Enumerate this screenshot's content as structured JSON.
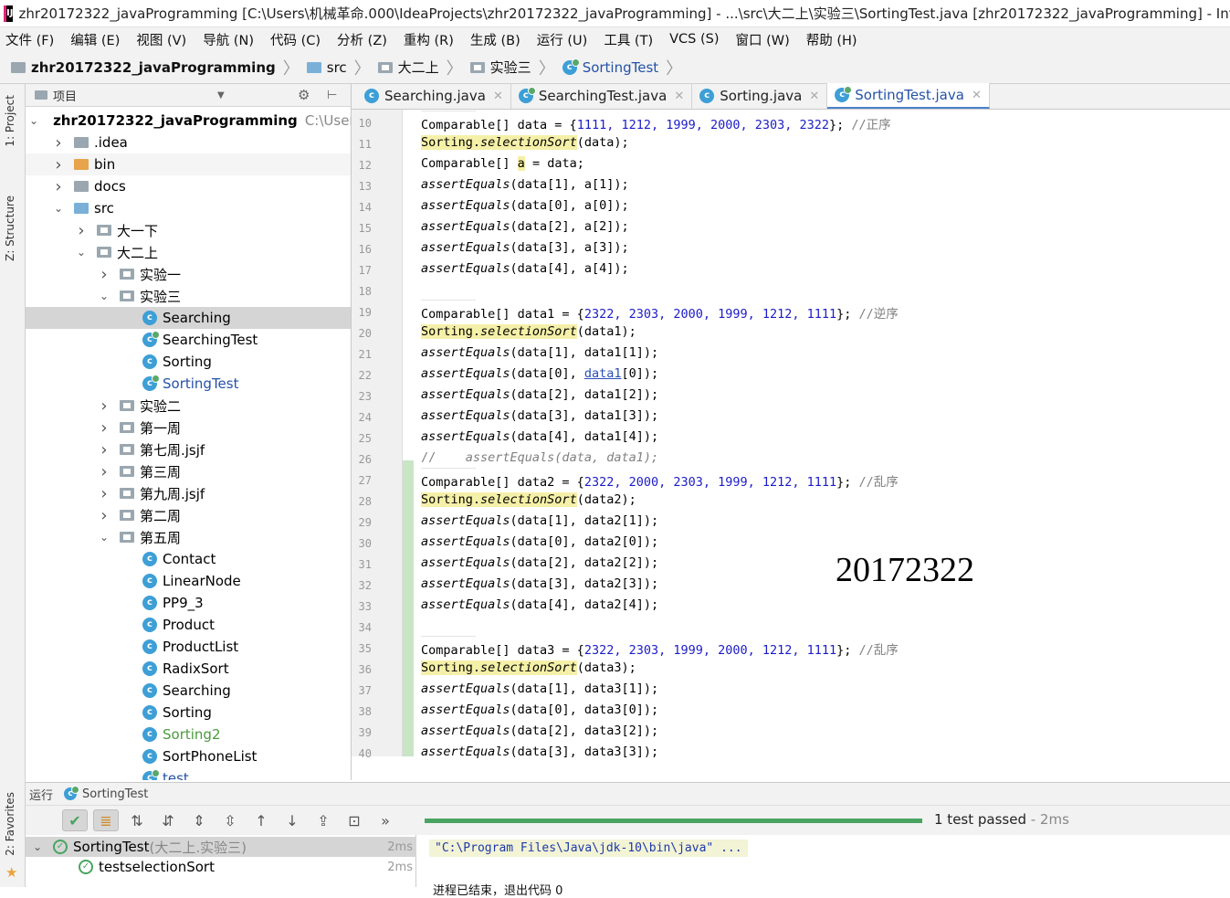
{
  "window": {
    "title": "zhr20172322_javaProgramming [C:\\Users\\机械革命.000\\IdeaProjects\\zhr20172322_javaProgramming] - ...\\src\\大二上\\实验三\\SortingTest.java [zhr20172322_javaProgramming] - IntelliJ",
    "app_icon": "IJ"
  },
  "menu": [
    "文件 (F)",
    "编辑 (E)",
    "视图 (V)",
    "导航 (N)",
    "代码 (C)",
    "分析 (Z)",
    "重构 (R)",
    "生成 (B)",
    "运行 (U)",
    "工具 (T)",
    "VCS (S)",
    "窗口 (W)",
    "帮助 (H)"
  ],
  "breadcrumb": [
    "zhr20172322_javaProgramming",
    "src",
    "大二上",
    "实验三",
    "SortingTest"
  ],
  "left_strip": {
    "project": "1: Project",
    "structure": "Z: Structure",
    "favorites": "2: Favorites"
  },
  "project_panel": {
    "header": "项目",
    "rows": [
      {
        "label": "zhr20172322_javaProgramming",
        "extra": "C:\\Users",
        "arrow": "down",
        "icon": "module"
      },
      {
        "label": ".idea",
        "arrow": "right",
        "icon": "folder"
      },
      {
        "label": "bin",
        "arrow": "right",
        "icon": "folder-orange"
      },
      {
        "label": "docs",
        "arrow": "right",
        "icon": "folder"
      },
      {
        "label": "src",
        "arrow": "down",
        "icon": "folder-blue"
      },
      {
        "label": "大一下",
        "arrow": "right",
        "icon": "package"
      },
      {
        "label": "大二上",
        "arrow": "down",
        "icon": "package"
      },
      {
        "label": "实验一",
        "arrow": "right",
        "icon": "package"
      },
      {
        "label": "实验三",
        "arrow": "down",
        "icon": "package"
      },
      {
        "label": "Searching",
        "icon": "class"
      },
      {
        "label": "SearchingTest",
        "icon": "class-test"
      },
      {
        "label": "Sorting",
        "icon": "class"
      },
      {
        "label": "SortingTest",
        "icon": "class-test"
      },
      {
        "label": "实验二",
        "arrow": "right",
        "icon": "package"
      },
      {
        "label": "第一周",
        "arrow": "right",
        "icon": "package"
      },
      {
        "label": "第七周.jsjf",
        "arrow": "right",
        "icon": "package"
      },
      {
        "label": "第三周",
        "arrow": "right",
        "icon": "package"
      },
      {
        "label": "第九周.jsjf",
        "arrow": "right",
        "icon": "package"
      },
      {
        "label": "第二周",
        "arrow": "right",
        "icon": "package"
      },
      {
        "label": "第五周",
        "arrow": "down",
        "icon": "package"
      },
      {
        "label": "Contact",
        "icon": "class"
      },
      {
        "label": "LinearNode",
        "icon": "class"
      },
      {
        "label": "PP9_3",
        "icon": "class"
      },
      {
        "label": "Product",
        "icon": "class"
      },
      {
        "label": "ProductList",
        "icon": "class"
      },
      {
        "label": "RadixSort",
        "icon": "class"
      },
      {
        "label": "Searching",
        "icon": "class"
      },
      {
        "label": "Sorting",
        "icon": "class"
      },
      {
        "label": "Sorting2",
        "icon": "class"
      },
      {
        "label": "SortPhoneList",
        "icon": "class"
      },
      {
        "label": "test",
        "icon": "class-test"
      }
    ]
  },
  "editor_tabs": [
    {
      "label": "Searching.java",
      "active": false
    },
    {
      "label": "SearchingTest.java",
      "active": false
    },
    {
      "label": "Sorting.java",
      "active": false
    },
    {
      "label": "SortingTest.java",
      "active": true
    }
  ],
  "code": {
    "line_numbers": [
      "10",
      "11",
      "12",
      "13",
      "14",
      "15",
      "16",
      "17",
      "18",
      "19",
      "20",
      "21",
      "22",
      "23",
      "24",
      "25",
      "26",
      "27",
      "28",
      "29",
      "30",
      "31",
      "32",
      "33",
      "34",
      "35",
      "36",
      "37",
      "38",
      "39",
      "40"
    ],
    "l10": {
      "pre": "Comparable[] data = {",
      "nums": "1111, 1212, 1999, 2000, 2303, 2322",
      "post": "}; ",
      "comment": "//正序"
    },
    "l11": {
      "cls": "Sorting.",
      "method": "selectionSort",
      "args": "(data);"
    },
    "l12": {
      "text_a": "Comparable[] ",
      "var": "a",
      "text_b": " = data;"
    },
    "l13": {
      "method": "assertEquals",
      "args": "(data[1], a[1]);"
    },
    "l14": {
      "method": "assertEquals",
      "args": "(data[0], a[0]);"
    },
    "l15": {
      "method": "assertEquals",
      "args": "(data[2], a[2]);"
    },
    "l16": {
      "method": "assertEquals",
      "args": "(data[3], a[3]);"
    },
    "l17": {
      "method": "assertEquals",
      "args": "(data[4], a[4]);"
    },
    "l19": {
      "pre": "Comparable[] data1 = {",
      "nums": "2322, 2303, 2000, 1999, 1212, 1111",
      "post": "}; ",
      "comment": "//逆序"
    },
    "l20": {
      "cls": "Sorting.",
      "method": "selectionSort",
      "args": "(data1);"
    },
    "l21": {
      "method": "assertEquals",
      "args": "(data[1], data1[1]);"
    },
    "l22": {
      "method": "assertEquals",
      "args_a": "(data[0], ",
      "link": "data1",
      "args_b": "[0]);"
    },
    "l23": {
      "method": "assertEquals",
      "args": "(data[2], data1[2]);"
    },
    "l24": {
      "method": "assertEquals",
      "args": "(data[3], data1[3]);"
    },
    "l25": {
      "method": "assertEquals",
      "args": "(data[4], data1[4]);"
    },
    "l26": {
      "comment": "//",
      "body": "    assertEquals(data, data1);"
    },
    "l27": {
      "pre": "Comparable[] data2 = {",
      "nums": "2322, 2000, 2303, 1999, 1212, 1111",
      "post": "}; ",
      "comment": "//乱序"
    },
    "l28": {
      "cls": "Sorting.",
      "method": "selectionSort",
      "args": "(data2);"
    },
    "l29": {
      "method": "assertEquals",
      "args": "(data[1], data2[1]);"
    },
    "l30": {
      "method": "assertEquals",
      "args": "(data[0], data2[0]);"
    },
    "l31": {
      "method": "assertEquals",
      "args": "(data[2], data2[2]);"
    },
    "l32": {
      "method": "assertEquals",
      "args": "(data[3], data2[3]);"
    },
    "l33": {
      "method": "assertEquals",
      "args": "(data[4], data2[4]);"
    },
    "l35": {
      "pre": "Comparable[] data3 = {",
      "nums": "2322, 2303, 1999, 2000, 1212, 1111",
      "post": "}; ",
      "comment": "//乱序"
    },
    "l36": {
      "cls": "Sorting.",
      "method": "selectionSort",
      "args": "(data3);"
    },
    "l37": {
      "method": "assertEquals",
      "args": "(data[1], data3[1]);"
    },
    "l38": {
      "method": "assertEquals",
      "args": "(data[0], data3[0]);"
    },
    "l39": {
      "method": "assertEquals",
      "args": "(data[2], data3[2]);"
    },
    "l40": {
      "method": "assertEquals",
      "args": "(data[3], data3[3]);"
    }
  },
  "watermark": "20172322",
  "run": {
    "header_label": "运行",
    "config": "SortingTest",
    "status": "1 test passed",
    "status_time": " - 2ms",
    "progress": 1.0,
    "tree": [
      {
        "label": "SortingTest",
        "suffix": " (大二上.实验三)",
        "dur": "2ms"
      },
      {
        "label": "testselectionSort",
        "dur": "2ms"
      }
    ],
    "console_line1": "\"C:\\Program Files\\Java\\jdk-10\\bin\\java\" ...",
    "console_line2": "进程已结束，退出代码 0"
  }
}
